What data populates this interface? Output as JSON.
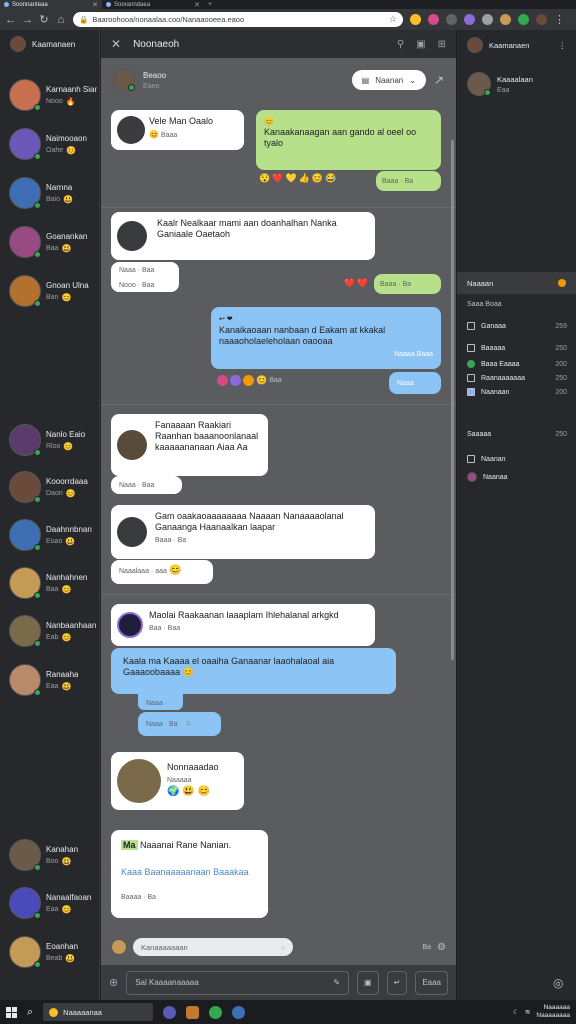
{
  "browser": {
    "tabs": [
      {
        "title": "Soonnanteaa"
      },
      {
        "title": "Sooranndaea"
      }
    ],
    "url": "Baaroohooa/nonaalaa.coo/Nanaaooeea.eaoo",
    "new_tab_label": "+"
  },
  "sidebar": {
    "me_name": "Kaamanaen",
    "contacts": [
      {
        "name": "Karnaanh Siar",
        "sub": "Nooo",
        "color": "#c86f4f",
        "emoji": "🔥"
      },
      {
        "name": "Naimooaon",
        "sub": "Oahe",
        "color": "#6a57b8",
        "emoji": "😊"
      },
      {
        "name": "Narnna",
        "sub": "Baio",
        "color": "#3e6fb5",
        "emoji": "😃"
      },
      {
        "name": "Goanankan",
        "sub": "Baa",
        "color": "#9a4a82",
        "emoji": "😃"
      },
      {
        "name": "Gnoan Ulna",
        "sub": "Ban",
        "color": "#b3702e",
        "emoji": "😊"
      },
      {
        "name": "Nanlo Eaio",
        "sub": "Rloo",
        "color": "#5a3b6b",
        "emoji": "😊"
      },
      {
        "name": "Kooorrdaaa",
        "sub": "Daon",
        "color": "#6a4a3a",
        "emoji": "😊"
      },
      {
        "name": "Daahnnbnan",
        "sub": "Eoao",
        "color": "#3e6fb5",
        "emoji": "😃"
      },
      {
        "name": "Nanhahnen",
        "sub": "Baa",
        "color": "#c49a57",
        "emoji": "😊"
      },
      {
        "name": "Nanbaanhaan",
        "sub": "Eab",
        "color": "#7a6a4a",
        "emoji": "😊"
      },
      {
        "name": "Ranaaha",
        "sub": "Eaa",
        "color": "#b88a6a",
        "emoji": "😃"
      },
      {
        "name": "Kanahan",
        "sub": "Boo",
        "color": "#6a5a4a",
        "emoji": "😃"
      },
      {
        "name": "Nanaalfaoan",
        "sub": "Eaa",
        "color": "#4a4ab8",
        "emoji": "😊"
      },
      {
        "name": "Eoanhan",
        "sub": "Beab",
        "color": "#c49a57",
        "emoji": "😃"
      }
    ]
  },
  "chat": {
    "header_title": "Noonaeoh",
    "sub_name": "Beaoo",
    "sub_status": "Eaeo",
    "pill_label": "Naanan",
    "messages": [
      {
        "name": "Vele Man Oaalo",
        "meta": "Baaa"
      },
      {
        "text": "Kanaakanaagan aan gando al oeel oo tyalo"
      },
      {
        "text": "Kaalr Nealkaar mami aan doanhalhan Nanka Ganiaale Oaetaoh",
        "meta1": "Naaa · Baa",
        "meta2": "Nooo · Baa"
      },
      {
        "text": "Kanaikaoaan nanbaan d Eakam at kkakal naaaoholaeleholaan oaooaa",
        "meta": "Naaaa Baaa"
      },
      {
        "text": "Fanaaaan Raakiari Raanhan baaanoonlanaal kaaaaananaan Aiaa Aa",
        "meta": "Naaa · Baa"
      },
      {
        "text": "Gam oaakaoaaaaaaaa Naaaan Nanaaaaolanal Ganaanga Haanaalkan laapar",
        "meta": "Baaa · Ba"
      },
      {
        "meta": "Naaalaaa · aaa"
      },
      {
        "text": "Maolai Raakaanan laaaplam Ihlehalanal arkgkd",
        "meta": "Baa · Baa"
      },
      {
        "text": "Kaala ma Kaaaa el oaaiha Ganaanar laaohalaoal aia Gaaaoobaaaa"
      },
      {
        "meta": "Naaa · Baa"
      },
      {
        "meta": "Naaa · Ba"
      },
      {
        "name": "Nonnaaadao",
        "meta": "Naaaaa"
      },
      {
        "highlight": "Ma",
        "text": "Naaanai Rane Nanian.",
        "blue_text": "Kaaa Baanaaaaanaan Baaakaa",
        "meta": "Baaaa · Ba"
      }
    ],
    "time_1": "Baaa · Ba",
    "time_2": "Baaa · Ba",
    "time_3": "Naaa",
    "reactions_1": [
      "😯",
      "❤️",
      "👍",
      "😊",
      "😂"
    ],
    "reaction_count": "Baa",
    "composer_placeholder": "Kanaaaaaaan",
    "composer_extra": "Ba",
    "footer_placeholder": "Sal Kaaaanaaaaa",
    "footer_button": "Eaaa"
  },
  "right_panel": {
    "profile_name": "Kaamanaen",
    "contact_name": "Kaaaalaan",
    "contact_sub": "Eaa",
    "section1_title": "Naaaan",
    "group_title": "Saaa Boaa",
    "items": [
      {
        "label": "Ganaaa",
        "count": "259"
      },
      {
        "label": "Baaaaa",
        "count": "250"
      },
      {
        "label": "Baaa Eaaaa",
        "count": "200"
      },
      {
        "label": "Raanaaaaaaa",
        "count": "250"
      },
      {
        "label": "Naanaan",
        "count": "200"
      }
    ],
    "section2_title": "Saaaaa",
    "section2_count": "250",
    "items2": [
      {
        "label": "Naanan"
      },
      {
        "label": "Naanaa"
      }
    ]
  },
  "taskbar": {
    "search_label": "Naaaaanaa",
    "time": "Naaaaaa",
    "date": "Naaaaaaaa"
  },
  "colors": {
    "green_bubble": "#b7e08a",
    "blue_bubble": "#8cc5f5",
    "white_bubble": "#ffffff",
    "chat_bg": "#5b5c60",
    "sidebar_bg": "#27282c"
  }
}
